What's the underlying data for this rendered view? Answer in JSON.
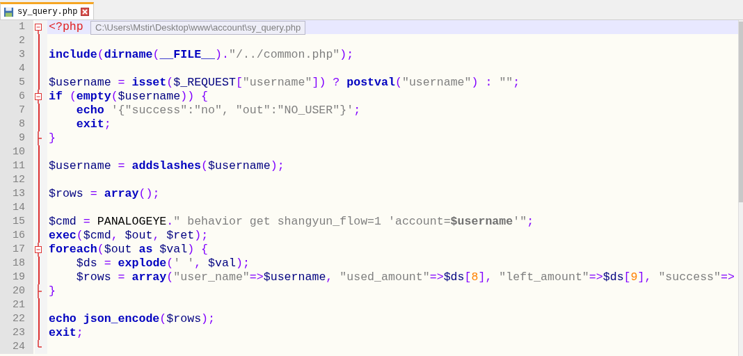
{
  "tabs": [
    {
      "label": "sy_query.php",
      "selected": true
    }
  ],
  "tooltip": "C:\\Users\\Mstir\\Desktop\\www\\account\\sy_query.php",
  "lines": [
    {
      "number": "1",
      "current": true,
      "fold_start": true,
      "tokens": [
        {
          "kind": "tag",
          "text": "<?php"
        }
      ]
    },
    {
      "number": "2"
    },
    {
      "number": "3",
      "tokens": [
        {
          "kind": "kw",
          "text": "include"
        },
        {
          "kind": "op",
          "text": "("
        },
        {
          "kind": "kw",
          "text": "dirname"
        },
        {
          "kind": "op",
          "text": "("
        },
        {
          "kind": "kw",
          "text": "__FILE__"
        },
        {
          "kind": "op",
          "text": ")."
        },
        {
          "kind": "str",
          "text": "\"/../common.php\""
        },
        {
          "kind": "op",
          "text": ");"
        }
      ]
    },
    {
      "number": "4"
    },
    {
      "number": "5",
      "tokens": [
        {
          "kind": "var",
          "text": "$username"
        },
        {
          "kind": "op",
          "text": " = "
        },
        {
          "kind": "kw",
          "text": "isset"
        },
        {
          "kind": "op",
          "text": "("
        },
        {
          "kind": "var",
          "text": "$_REQUEST"
        },
        {
          "kind": "op",
          "text": "["
        },
        {
          "kind": "str",
          "text": "\"username\""
        },
        {
          "kind": "op",
          "text": "]) ? "
        },
        {
          "kind": "kw",
          "text": "postval"
        },
        {
          "kind": "op",
          "text": "("
        },
        {
          "kind": "str",
          "text": "\"username\""
        },
        {
          "kind": "op",
          "text": ") : "
        },
        {
          "kind": "str",
          "text": "\"\""
        },
        {
          "kind": "op",
          "text": ";"
        }
      ]
    },
    {
      "number": "6",
      "fold_start": true,
      "tokens": [
        {
          "kind": "kw",
          "text": "if"
        },
        {
          "kind": "op",
          "text": " ("
        },
        {
          "kind": "kw",
          "text": "empty"
        },
        {
          "kind": "op",
          "text": "("
        },
        {
          "kind": "var",
          "text": "$username"
        },
        {
          "kind": "op",
          "text": ")) {"
        }
      ]
    },
    {
      "number": "7",
      "tokens": [
        {
          "kind": "kw",
          "text": "    echo"
        },
        {
          "kind": "str",
          "text": " '{\"success\":\"no\", \"out\":\"NO_USER\"}'"
        },
        {
          "kind": "op",
          "text": ";"
        }
      ]
    },
    {
      "number": "8",
      "tokens": [
        {
          "kind": "kw",
          "text": "    exit"
        },
        {
          "kind": "op",
          "text": ";"
        }
      ]
    },
    {
      "number": "9",
      "fold_end": true,
      "tokens": [
        {
          "kind": "op",
          "text": "}"
        }
      ]
    },
    {
      "number": "10"
    },
    {
      "number": "11",
      "tokens": [
        {
          "kind": "var",
          "text": "$username"
        },
        {
          "kind": "op",
          "text": " = "
        },
        {
          "kind": "kw",
          "text": "addslashes"
        },
        {
          "kind": "op",
          "text": "("
        },
        {
          "kind": "var",
          "text": "$username"
        },
        {
          "kind": "op",
          "text": ");"
        }
      ]
    },
    {
      "number": "12"
    },
    {
      "number": "13",
      "tokens": [
        {
          "kind": "var",
          "text": "$rows"
        },
        {
          "kind": "op",
          "text": " = "
        },
        {
          "kind": "kw",
          "text": "array"
        },
        {
          "kind": "op",
          "text": "();"
        }
      ]
    },
    {
      "number": "14"
    },
    {
      "number": "15",
      "tokens": [
        {
          "kind": "var",
          "text": "$cmd"
        },
        {
          "kind": "op",
          "text": " = "
        },
        {
          "kind": "const",
          "text": "PANALOGEYE"
        },
        {
          "kind": "op",
          "text": "."
        },
        {
          "kind": "str",
          "text": "\" behavior get shangyun_flow=1 'account="
        },
        {
          "kind": "strvar",
          "text": "$username"
        },
        {
          "kind": "str",
          "text": "'\""
        },
        {
          "kind": "op",
          "text": ";"
        }
      ]
    },
    {
      "number": "16",
      "tokens": [
        {
          "kind": "kw",
          "text": "exec"
        },
        {
          "kind": "op",
          "text": "("
        },
        {
          "kind": "var",
          "text": "$cmd"
        },
        {
          "kind": "op",
          "text": ", "
        },
        {
          "kind": "var",
          "text": "$out"
        },
        {
          "kind": "op",
          "text": ", "
        },
        {
          "kind": "var",
          "text": "$ret"
        },
        {
          "kind": "op",
          "text": ");"
        }
      ]
    },
    {
      "number": "17",
      "fold_start": true,
      "tokens": [
        {
          "kind": "kw",
          "text": "foreach"
        },
        {
          "kind": "op",
          "text": "("
        },
        {
          "kind": "var",
          "text": "$out "
        },
        {
          "kind": "kw",
          "text": "as"
        },
        {
          "kind": "var",
          "text": " $val"
        },
        {
          "kind": "op",
          "text": ") {"
        }
      ]
    },
    {
      "number": "18",
      "tokens": [
        {
          "kind": "var",
          "text": "    $ds"
        },
        {
          "kind": "op",
          "text": " = "
        },
        {
          "kind": "kw",
          "text": "explode"
        },
        {
          "kind": "op",
          "text": "("
        },
        {
          "kind": "str",
          "text": "' '"
        },
        {
          "kind": "op",
          "text": ", "
        },
        {
          "kind": "var",
          "text": "$val"
        },
        {
          "kind": "op",
          "text": ");"
        }
      ]
    },
    {
      "number": "19",
      "tokens": [
        {
          "kind": "var",
          "text": "    $rows"
        },
        {
          "kind": "op",
          "text": " = "
        },
        {
          "kind": "kw",
          "text": "array"
        },
        {
          "kind": "op",
          "text": "("
        },
        {
          "kind": "str",
          "text": "\"user_name\""
        },
        {
          "kind": "op",
          "text": "=>"
        },
        {
          "kind": "var",
          "text": "$username"
        },
        {
          "kind": "op",
          "text": ", "
        },
        {
          "kind": "str",
          "text": "\"used_amount\""
        },
        {
          "kind": "op",
          "text": "=>"
        },
        {
          "kind": "var",
          "text": "$ds"
        },
        {
          "kind": "op",
          "text": "["
        },
        {
          "kind": "num",
          "text": "8"
        },
        {
          "kind": "op",
          "text": "], "
        },
        {
          "kind": "str",
          "text": "\"left_amount\""
        },
        {
          "kind": "op",
          "text": "=>"
        },
        {
          "kind": "var",
          "text": "$ds"
        },
        {
          "kind": "op",
          "text": "["
        },
        {
          "kind": "num",
          "text": "9"
        },
        {
          "kind": "op",
          "text": "], "
        },
        {
          "kind": "str",
          "text": "\"success\""
        },
        {
          "kind": "op",
          "text": "=>"
        }
      ]
    },
    {
      "number": "20",
      "fold_end": true,
      "tokens": [
        {
          "kind": "op",
          "text": "}"
        }
      ]
    },
    {
      "number": "21"
    },
    {
      "number": "22",
      "tokens": [
        {
          "kind": "kw",
          "text": "echo json_encode"
        },
        {
          "kind": "op",
          "text": "("
        },
        {
          "kind": "var",
          "text": "$rows"
        },
        {
          "kind": "op",
          "text": ");"
        }
      ]
    },
    {
      "number": "23",
      "tokens": [
        {
          "kind": "kw",
          "text": "exit"
        },
        {
          "kind": "op",
          "text": ";"
        }
      ]
    },
    {
      "number": "24",
      "fold_end": true
    }
  ]
}
